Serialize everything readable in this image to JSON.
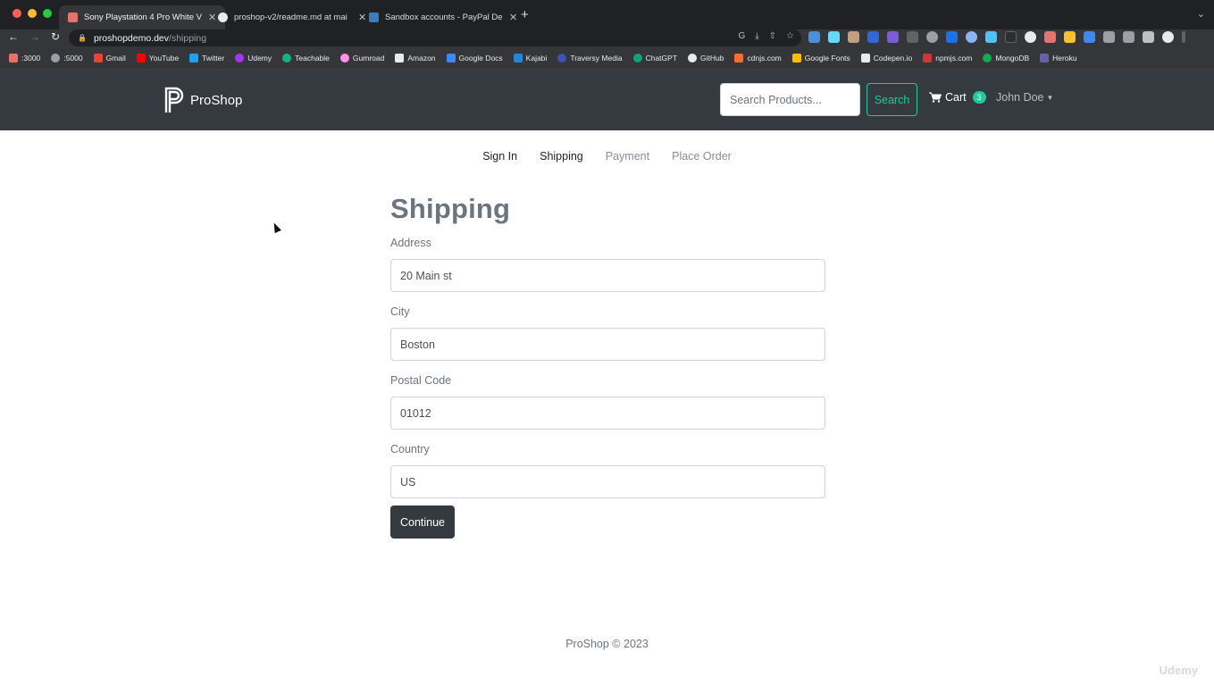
{
  "browser": {
    "tabs": [
      {
        "title": "Sony Playstation 4 Pro White V",
        "active": true
      },
      {
        "title": "proshop-v2/readme.md at mai",
        "active": false
      },
      {
        "title": "Sandbox accounts - PayPal De",
        "active": false
      }
    ],
    "url_host": "proshopdemo.dev",
    "url_path": "/shipping",
    "bookmarks": [
      ":3000",
      ":5000",
      "Gmail",
      "YouTube",
      "Twitter",
      "Udemy",
      "Teachable",
      "Gumroad",
      "Amazon",
      "Google Docs",
      "Kajabi",
      "Traversy Media",
      "ChatGPT",
      "GitHub",
      "cdnjs.com",
      "Google Fonts",
      "Codepen.io",
      "npmjs.com",
      "MongoDB",
      "Heroku"
    ]
  },
  "header": {
    "brand": "ProShop",
    "search_placeholder": "Search Products...",
    "search_label": "Search",
    "cart_label": "Cart",
    "cart_count": "3",
    "user_name": "John Doe"
  },
  "steps": [
    {
      "label": "Sign In",
      "state": "active"
    },
    {
      "label": "Shipping",
      "state": "active"
    },
    {
      "label": "Payment",
      "state": "disabled"
    },
    {
      "label": "Place Order",
      "state": "disabled"
    }
  ],
  "form": {
    "title": "Shipping",
    "address_label": "Address",
    "address_value": "20 Main st",
    "city_label": "City",
    "city_value": "Boston",
    "postal_label": "Postal Code",
    "postal_value": "01012",
    "country_label": "Country",
    "country_value": "US",
    "continue_label": "Continue"
  },
  "footer": {
    "text": "ProShop © 2023"
  },
  "watermark": "Udemy",
  "colors": {
    "navbar": "#343a40",
    "accent": "#20c997",
    "button": "#343a40"
  }
}
